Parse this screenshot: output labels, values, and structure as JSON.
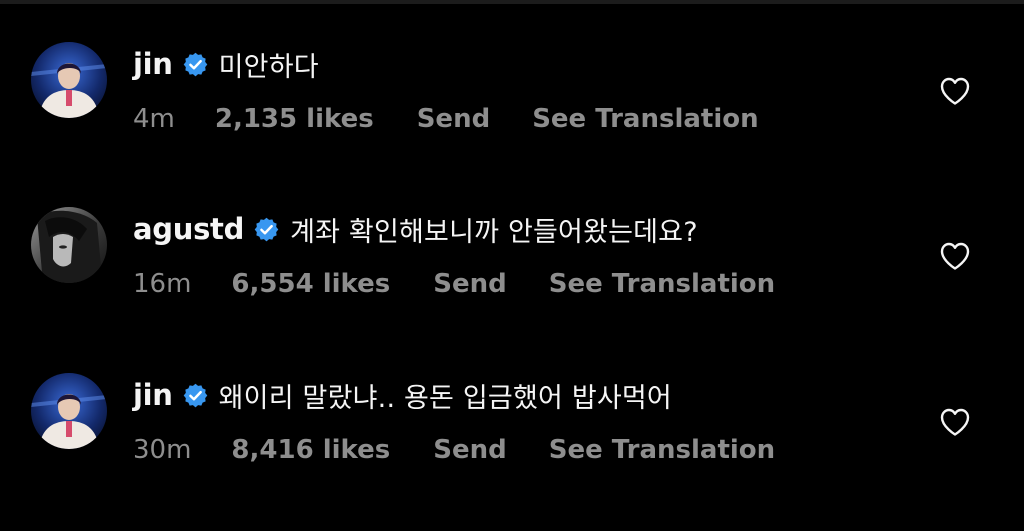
{
  "comments": [
    {
      "username": "jin",
      "text": "미안하다",
      "time": "4m",
      "likes": "2,135 likes",
      "send_label": "Send",
      "translate_label": "See Translation",
      "avatar_icon": "profile-photo-jin"
    },
    {
      "username": "agustd",
      "text": "계좌 확인해보니까 안들어왔는데요?",
      "time": "16m",
      "likes": "6,554 likes",
      "send_label": "Send",
      "translate_label": "See Translation",
      "avatar_icon": "profile-photo-agustd"
    },
    {
      "username": "jin",
      "text": "왜이리 말랐냐.. 용돈 입금했어 밥사먹어",
      "time": "30m",
      "likes": "8,416 likes",
      "send_label": "Send",
      "translate_label": "See Translation",
      "avatar_icon": "profile-photo-jin"
    }
  ],
  "colors": {
    "background": "#000000",
    "primary_text": "#f5f5f5",
    "secondary_text": "#8e8e8e",
    "verified_badge": "#3897f0"
  },
  "icons": {
    "verified": "verified-badge-icon",
    "like": "heart-outline-icon"
  }
}
